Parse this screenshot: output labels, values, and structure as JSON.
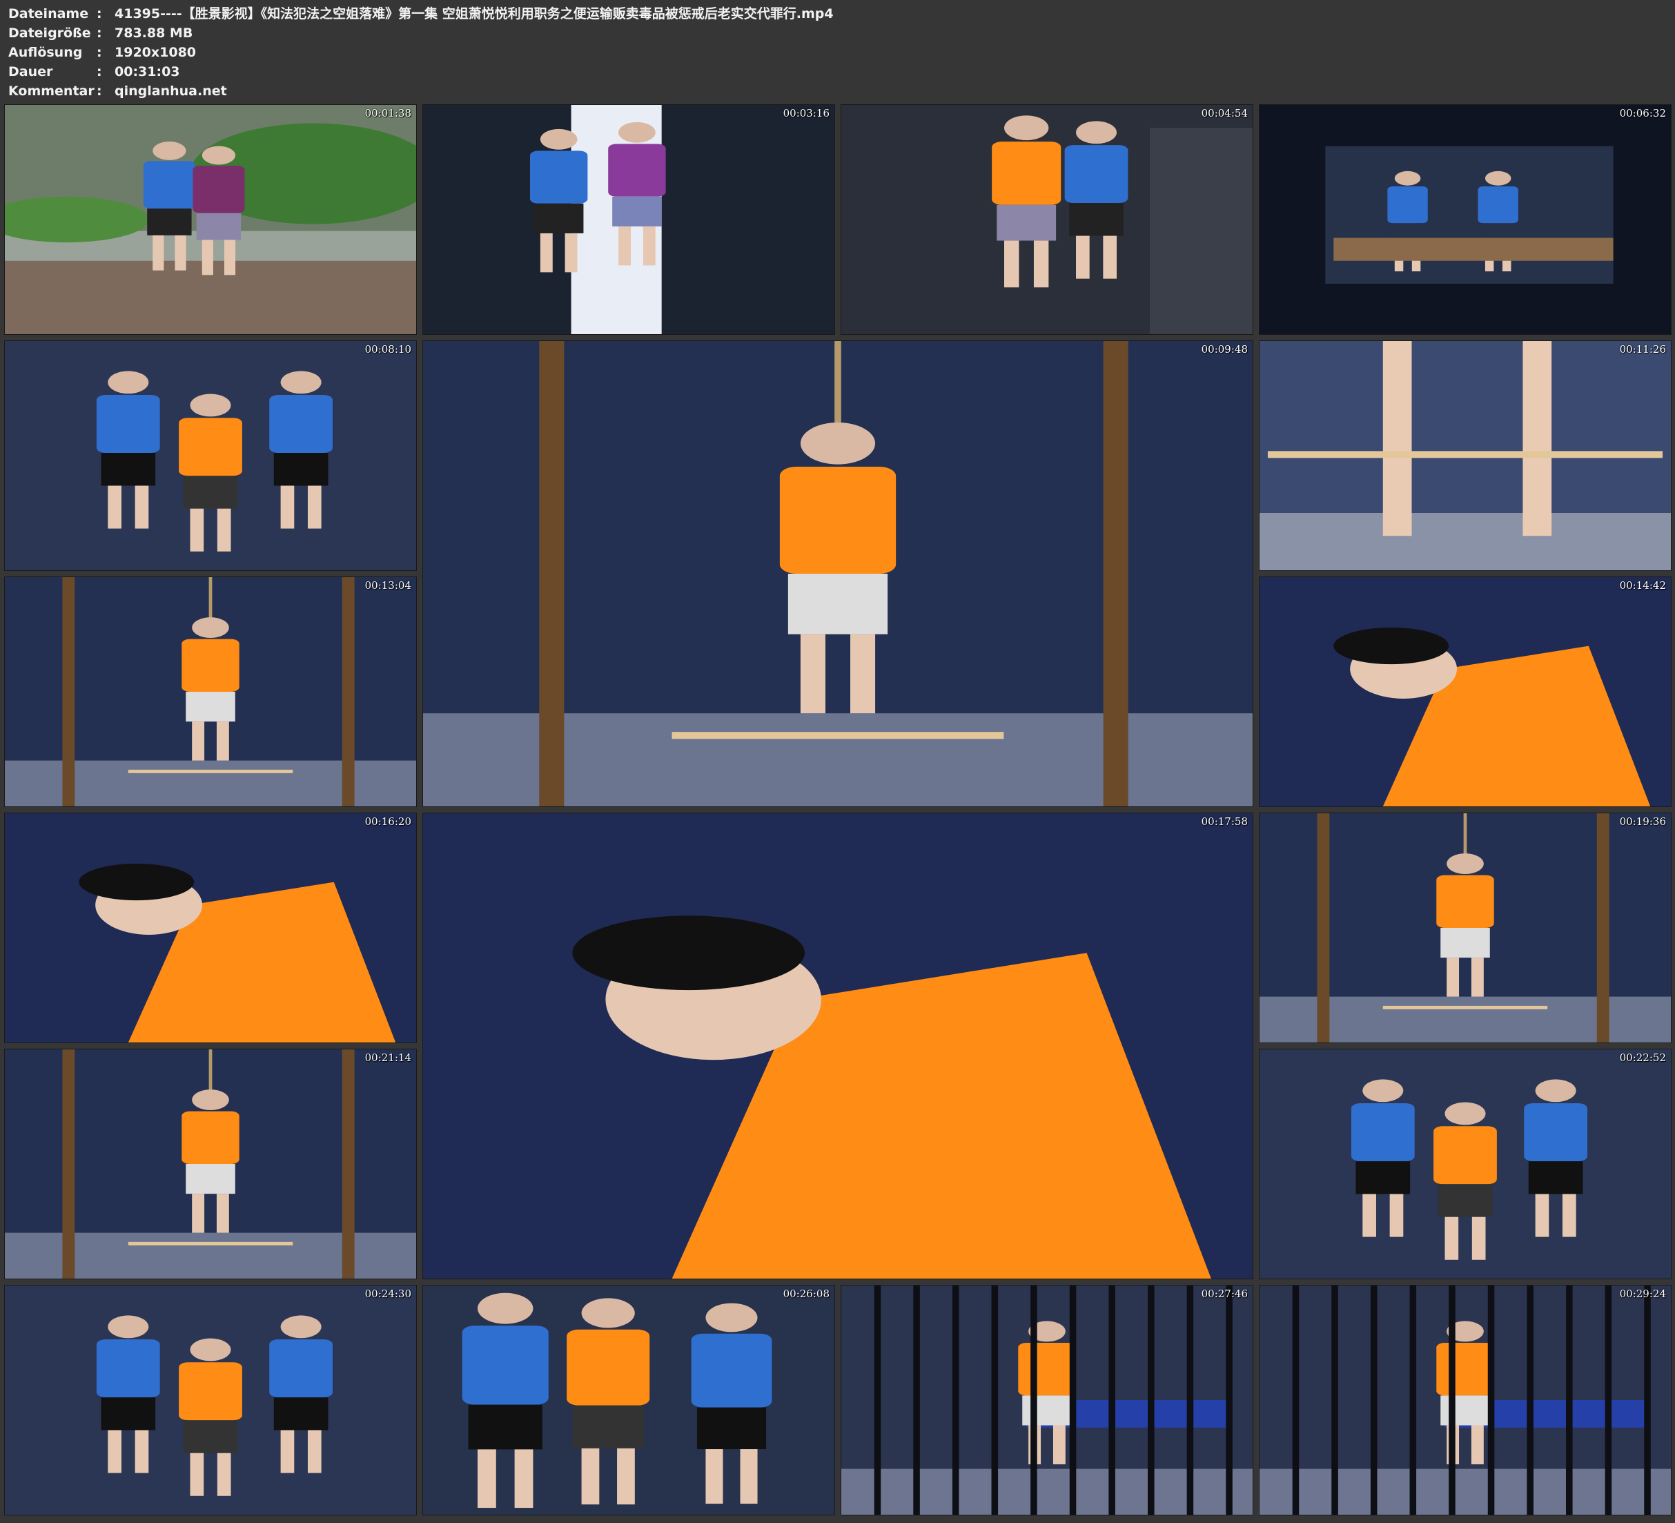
{
  "header": {
    "rows": [
      {
        "key": "Dateiname",
        "value": "41395----【胜景影视】《知法犯法之空姐落难》第一集 空姐萧悦悦利用职务之便运输贩卖毒品被惩戒后老实交代罪行.mp4"
      },
      {
        "key": "Dateigröße",
        "value": "783.88 MB"
      },
      {
        "key": "Auflösung",
        "value": "1920x1080"
      },
      {
        "key": "Dauer",
        "value": "00:31:03"
      },
      {
        "key": "Kommentar",
        "value": "qinglanhua.net"
      }
    ],
    "separator": ":"
  },
  "thumbnails": [
    {
      "timestamp": "00:01:38",
      "scene": "outdoor"
    },
    {
      "timestamp": "00:03:16",
      "scene": "height-chart"
    },
    {
      "timestamp": "00:04:54",
      "scene": "corridor"
    },
    {
      "timestamp": "00:06:32",
      "scene": "desk"
    },
    {
      "timestamp": "00:08:10",
      "scene": "seated"
    },
    {
      "timestamp": "00:09:48",
      "scene": "cell-wide"
    },
    {
      "timestamp": "00:11:26",
      "scene": "legs"
    },
    {
      "timestamp": "00:13:04",
      "scene": "cell-wide"
    },
    {
      "timestamp": "00:14:42",
      "scene": "closeup"
    },
    {
      "timestamp": "00:16:20",
      "scene": "closeup"
    },
    {
      "timestamp": "00:17:58",
      "scene": "closeup"
    },
    {
      "timestamp": "00:19:36",
      "scene": "cell-wide"
    },
    {
      "timestamp": "00:21:14",
      "scene": "cell-wide"
    },
    {
      "timestamp": "00:22:52",
      "scene": "seated"
    },
    {
      "timestamp": "00:24:30",
      "scene": "seated"
    },
    {
      "timestamp": "00:26:08",
      "scene": "standing"
    },
    {
      "timestamp": "00:27:46",
      "scene": "bars"
    },
    {
      "timestamp": "00:29:24",
      "scene": "bars"
    }
  ],
  "colors": {
    "background": "#363636",
    "text": "#f2f2f2",
    "uniform_blue": "#2f6fd0",
    "vest_orange": "#ff8c14",
    "cell_blue": "#1d2740"
  }
}
